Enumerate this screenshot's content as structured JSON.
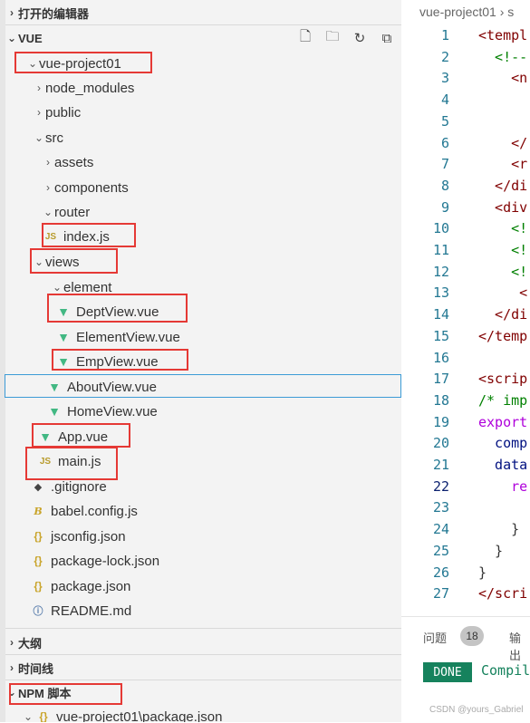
{
  "sidebar": {
    "open_editors": "打开的编辑器",
    "project_section": "VUE",
    "outline": "大纲",
    "timeline": "时间线",
    "npm_scripts": "NPM 脚本",
    "npm_package": "vue-project01\\package.json",
    "tree": [
      {
        "label": "vue-project01",
        "twisty": "v",
        "icon": ""
      },
      {
        "label": "node_modules",
        "twisty": ">",
        "icon": ""
      },
      {
        "label": "public",
        "twisty": ">",
        "icon": ""
      },
      {
        "label": "src",
        "twisty": "v",
        "icon": ""
      },
      {
        "label": "assets",
        "twisty": ">",
        "icon": ""
      },
      {
        "label": "components",
        "twisty": ">",
        "icon": ""
      },
      {
        "label": "router",
        "twisty": "v",
        "icon": ""
      },
      {
        "label": "index.js",
        "twisty": "",
        "icon": "JS"
      },
      {
        "label": "views",
        "twisty": "v",
        "icon": ""
      },
      {
        "label": "element",
        "twisty": "v",
        "icon": ""
      },
      {
        "label": "DeptView.vue",
        "twisty": "",
        "icon": "V"
      },
      {
        "label": "ElementView.vue",
        "twisty": "",
        "icon": "V"
      },
      {
        "label": "EmpView.vue",
        "twisty": "",
        "icon": "V"
      },
      {
        "label": "AboutView.vue",
        "twisty": "",
        "icon": "V"
      },
      {
        "label": "HomeView.vue",
        "twisty": "",
        "icon": "V"
      },
      {
        "label": "App.vue",
        "twisty": "",
        "icon": "V"
      },
      {
        "label": "main.js",
        "twisty": "",
        "icon": "JS"
      },
      {
        "label": ".gitignore",
        "twisty": "",
        "icon": "◆"
      },
      {
        "label": "babel.config.js",
        "twisty": "",
        "icon": "B"
      },
      {
        "label": "jsconfig.json",
        "twisty": "",
        "icon": "{}"
      },
      {
        "label": "package-lock.json",
        "twisty": "",
        "icon": "{}"
      },
      {
        "label": "package.json",
        "twisty": "",
        "icon": "{}"
      },
      {
        "label": "README.md",
        "twisty": "",
        "icon": "ⓘ"
      }
    ]
  },
  "editor": {
    "breadcrumb": "vue-project01 › s",
    "active_line": 22,
    "lines": [
      {
        "n": "1",
        "t": "<templ"
      },
      {
        "n": "2",
        "t": "  <!--"
      },
      {
        "n": "3",
        "t": "    <n"
      },
      {
        "n": "4",
        "t": ""
      },
      {
        "n": "5",
        "t": ""
      },
      {
        "n": "6",
        "t": "    </"
      },
      {
        "n": "7",
        "t": "    <r"
      },
      {
        "n": "8",
        "t": "  </di"
      },
      {
        "n": "9",
        "t": "  <div"
      },
      {
        "n": "10",
        "t": "    <!"
      },
      {
        "n": "11",
        "t": "    <!"
      },
      {
        "n": "12",
        "t": "    <!"
      },
      {
        "n": "13",
        "t": "     <"
      },
      {
        "n": "14",
        "t": "  </di"
      },
      {
        "n": "15",
        "t": "</temp"
      },
      {
        "n": "16",
        "t": ""
      },
      {
        "n": "17",
        "t": "<scrip"
      },
      {
        "n": "18",
        "t": "/* imp"
      },
      {
        "n": "19",
        "t": "export"
      },
      {
        "n": "20",
        "t": "  comp"
      },
      {
        "n": "21",
        "t": "  data"
      },
      {
        "n": "22",
        "t": "    re"
      },
      {
        "n": "23",
        "t": ""
      },
      {
        "n": "24",
        "t": "    }"
      },
      {
        "n": "25",
        "t": "  }"
      },
      {
        "n": "26",
        "t": "}"
      },
      {
        "n": "27",
        "t": "</scri"
      }
    ]
  },
  "panel": {
    "problems_tab": "问题",
    "problems_count": "18",
    "output_tab": "输出",
    "done_label": "DONE",
    "status_text": "Compil"
  },
  "watermark": "CSDN @yours_Gabriel"
}
